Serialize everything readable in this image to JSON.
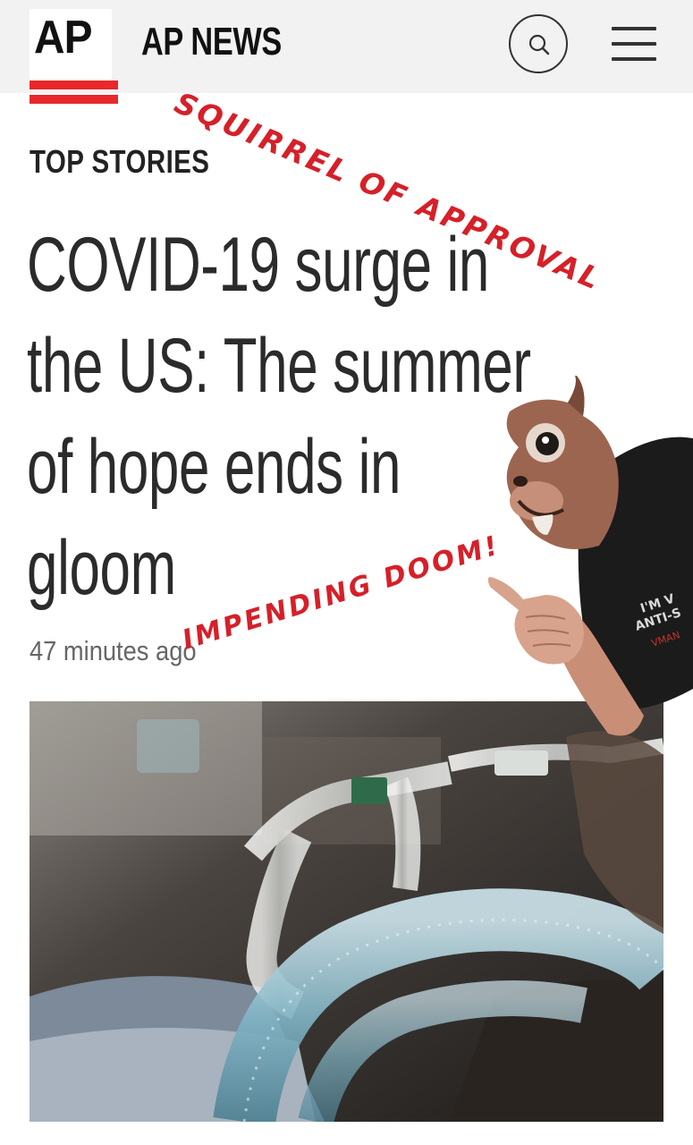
{
  "header": {
    "logo_text": "AP",
    "brand_name": "AP NEWS",
    "search_icon": "search-icon",
    "menu_icon": "hamburger-menu-icon"
  },
  "article": {
    "section": "TOP STORIES",
    "headline": "COVID-19 surge in the US: The summer of hope ends in gloom",
    "timestamp": "47 minutes ago"
  },
  "annotations": {
    "top": "SQUIRREL OF APPROVAL",
    "bottom": "IMPENDING DOOM!",
    "shirt_text": "I'M VANTI-S... VMAN"
  },
  "colors": {
    "brand_red": "#e8282b",
    "scribble_red": "#d62029",
    "header_bg": "#f2f2f2",
    "text": "#2b2b2b"
  }
}
